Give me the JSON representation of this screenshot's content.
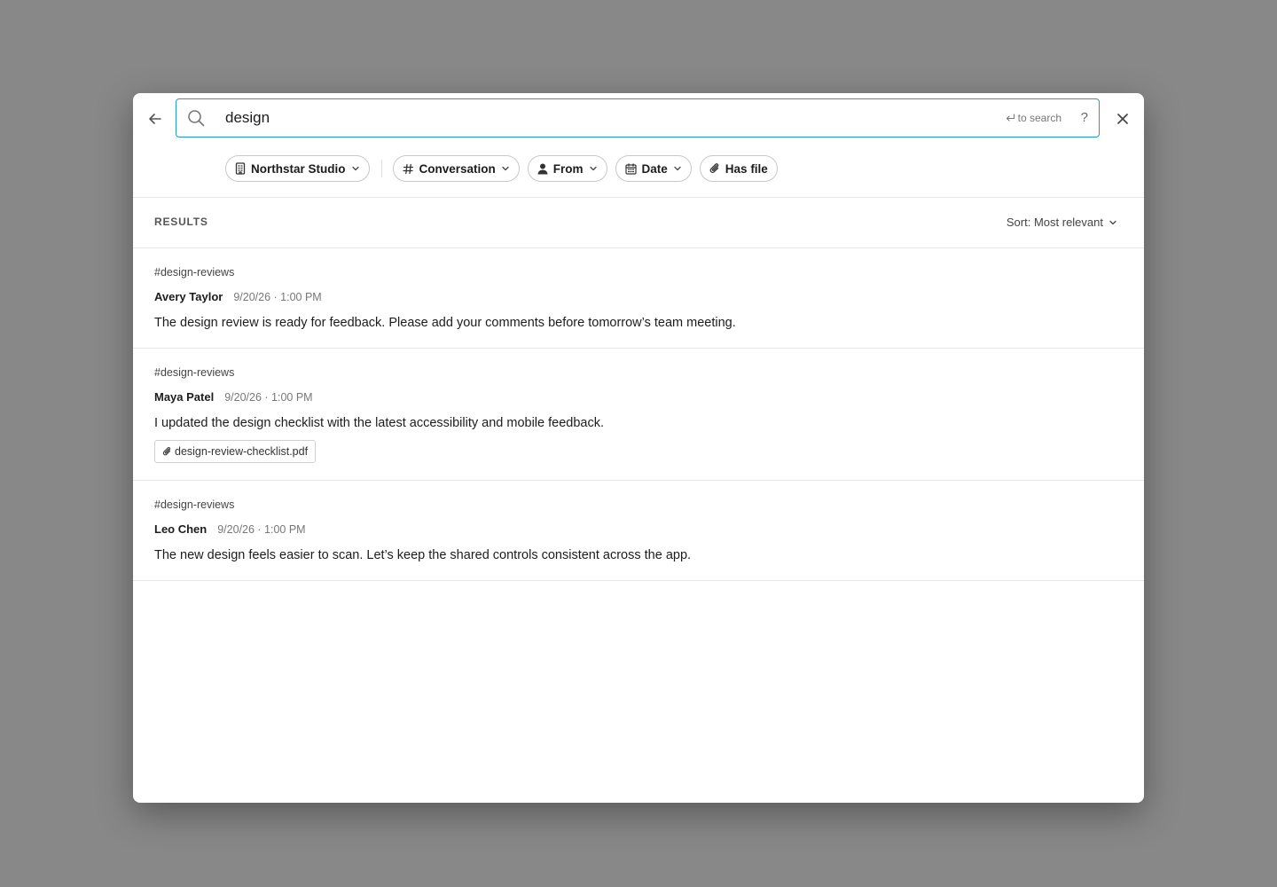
{
  "search": {
    "query": "design",
    "hint": "to search",
    "help": "?"
  },
  "filters": [
    {
      "label": "Northstar Studio",
      "icon": "building-icon"
    },
    {
      "label": "Conversation",
      "icon": "hash-icon"
    },
    {
      "label": "From",
      "icon": "person-icon"
    },
    {
      "label": "Date",
      "icon": "calendar-icon"
    },
    {
      "label": "Has file",
      "icon": "paperclip-icon"
    }
  ],
  "results": {
    "header": "RESULTS",
    "sort_label": "Sort: Most relevant",
    "items": [
      {
        "channel": "#design-reviews",
        "author": "Avery Taylor",
        "time": "9/20/26 · 1:00 PM",
        "text": "The design review is ready for feedback. Please add your comments before tomorrow’s team meeting."
      },
      {
        "channel": "#design-reviews",
        "author": "Maya Patel",
        "time": "9/20/26 · 1:00 PM",
        "text": "I updated the design checklist with the latest accessibility and mobile feedback.",
        "attachment": "design-review-checklist.pdf"
      },
      {
        "channel": "#design-reviews",
        "author": "Leo Chen",
        "time": "9/20/26 · 1:00 PM",
        "text": "The new design feels easier to scan. Let’s keep the shared controls consistent across the app."
      }
    ]
  },
  "colors": {
    "accent": "#1d9bd1",
    "backdrop": "#888888"
  }
}
